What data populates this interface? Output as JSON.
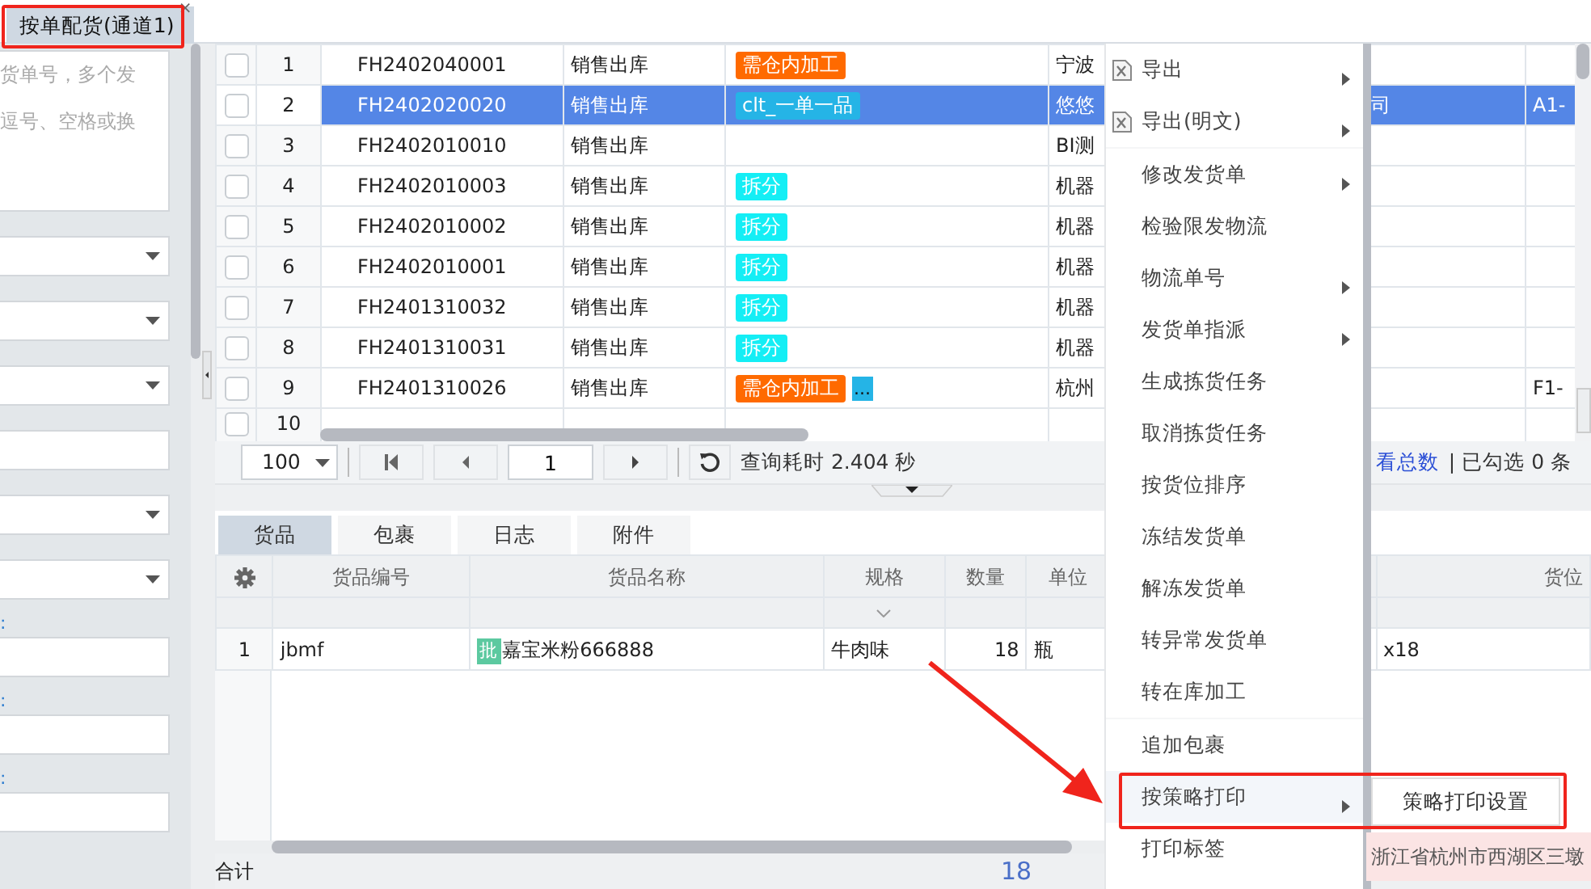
{
  "tab": {
    "label": "按单配货(通道1)",
    "close": "×",
    "selected": true
  },
  "filter_panel": {
    "placeholder": "货单号，多个发逗号、空格或换",
    "fields": [
      {
        "kind": "select"
      },
      {
        "kind": "select"
      },
      {
        "kind": "select"
      },
      {
        "kind": "input"
      },
      {
        "kind": "select"
      },
      {
        "kind": "select"
      },
      {
        "kind": "input",
        "label": ":"
      },
      {
        "kind": "input",
        "label": ":"
      },
      {
        "kind": "input",
        "label": ":"
      }
    ]
  },
  "orders": {
    "rows": [
      {
        "no": "1",
        "code": "FH2402040001",
        "type": "销售出库",
        "tags": [
          {
            "text": "需仓内加工",
            "color": "#ff6a00"
          }
        ],
        "column_5": "宁波",
        "column_6": "",
        "column_7": "",
        "checked": false,
        "selected": false
      },
      {
        "no": "2",
        "code": "FH2402020020",
        "type": "销售出库",
        "tags": [
          {
            "text": "clt_一单一品",
            "color": "#25b4e6"
          }
        ],
        "column_5": "悠悠",
        "column_6": "司",
        "column_7": "A1-",
        "checked": false,
        "selected": true
      },
      {
        "no": "3",
        "code": "FH2402010010",
        "type": "销售出库",
        "tags": [],
        "column_5": "BI测",
        "column_6": "",
        "column_7": "",
        "checked": false,
        "selected": false
      },
      {
        "no": "4",
        "code": "FH2402010003",
        "type": "销售出库",
        "tags": [
          {
            "text": "拆分",
            "color": "#14eef5"
          }
        ],
        "column_5": "机器",
        "column_6": "",
        "column_7": "",
        "checked": false,
        "selected": false
      },
      {
        "no": "5",
        "code": "FH2402010002",
        "type": "销售出库",
        "tags": [
          {
            "text": "拆分",
            "color": "#14eef5"
          }
        ],
        "column_5": "机器",
        "column_6": "",
        "column_7": "",
        "checked": false,
        "selected": false
      },
      {
        "no": "6",
        "code": "FH2402010001",
        "type": "销售出库",
        "tags": [
          {
            "text": "拆分",
            "color": "#14eef5"
          }
        ],
        "column_5": "机器",
        "column_6": "",
        "column_7": "",
        "checked": false,
        "selected": false
      },
      {
        "no": "7",
        "code": "FH2401310032",
        "type": "销售出库",
        "tags": [
          {
            "text": "拆分",
            "color": "#14eef5"
          }
        ],
        "column_5": "机器",
        "column_6": "",
        "column_7": "",
        "checked": false,
        "selected": false
      },
      {
        "no": "8",
        "code": "FH2401310031",
        "type": "销售出库",
        "tags": [
          {
            "text": "拆分",
            "color": "#14eef5"
          }
        ],
        "column_5": "机器",
        "column_6": "",
        "column_7": "",
        "checked": false,
        "selected": false
      },
      {
        "no": "9",
        "code": "FH2401310026",
        "type": "销售出库",
        "tags": [
          {
            "text": "需仓内加工",
            "color": "#ff6a00"
          }
        ],
        "more": "...",
        "column_5": "杭州",
        "column_6": "",
        "column_7": "F1-",
        "checked": false,
        "selected": false
      },
      {
        "no": "10",
        "code": "",
        "type": "",
        "tags": [],
        "column_5": "",
        "column_6": "",
        "column_7": "",
        "checked": false,
        "selected": false
      }
    ]
  },
  "pager": {
    "page_size": "100",
    "page": "1",
    "query_time": "查询耗时 2.404 秒",
    "total_link": "看总数",
    "checked_count": "| 已勾选 0 条"
  },
  "detail_tabs": [
    {
      "label": "货品",
      "selected": true
    },
    {
      "label": "包裹",
      "selected": false
    },
    {
      "label": "日志",
      "selected": false
    },
    {
      "label": "附件",
      "selected": false
    }
  ],
  "items": {
    "columns": [
      "货品编号",
      "货品名称",
      "规格",
      "数量",
      "单位",
      "",
      "货位"
    ],
    "rows": [
      {
        "no": "1",
        "code": "jbmf",
        "badge": "批",
        "name": "嘉宝米粉666888",
        "spec": "牛肉味",
        "qty": "18",
        "unit": "瓶",
        "column_7": "x18"
      }
    ],
    "total_label": "合计",
    "total_qty": "18"
  },
  "address_tip": "浙江省杭州市西湖区三墩",
  "context_menu": {
    "sections": [
      [
        {
          "label": "导出",
          "kind": "export",
          "has_submenu": true,
          "expanded": false
        },
        {
          "label": "导出(明文)",
          "kind": "export",
          "has_submenu": true,
          "expanded": false
        }
      ],
      [
        {
          "label": "修改发货单",
          "kind": "plain",
          "has_submenu": true,
          "expanded": false
        },
        {
          "label": "检验限发物流",
          "kind": "plain",
          "has_submenu": false,
          "expanded": false
        },
        {
          "label": "物流单号",
          "kind": "plain",
          "has_submenu": true,
          "expanded": false
        },
        {
          "label": "发货单指派",
          "kind": "plain",
          "has_submenu": true,
          "expanded": false
        },
        {
          "label": "生成拣货任务",
          "kind": "plain",
          "has_submenu": false,
          "expanded": false
        },
        {
          "label": "取消拣货任务",
          "kind": "plain",
          "has_submenu": false,
          "expanded": false
        },
        {
          "label": "按货位排序",
          "kind": "plain",
          "has_submenu": false,
          "expanded": false
        },
        {
          "label": "冻结发货单",
          "kind": "plain",
          "has_submenu": false,
          "expanded": false
        },
        {
          "label": "解冻发货单",
          "kind": "plain",
          "has_submenu": false,
          "expanded": false
        },
        {
          "label": "转异常发货单",
          "kind": "plain",
          "has_submenu": false,
          "expanded": false
        },
        {
          "label": "转在库加工",
          "kind": "plain",
          "has_submenu": false,
          "expanded": false
        }
      ],
      [
        {
          "label": "追加包裹",
          "kind": "plain",
          "has_submenu": false,
          "expanded": false
        },
        {
          "label": "按策略打印",
          "kind": "plain",
          "has_submenu": true,
          "expanded": true,
          "submenu": [
            "策略打印设置"
          ]
        },
        {
          "label": "打印标签",
          "kind": "plain",
          "has_submenu": false,
          "expanded": false
        }
      ]
    ]
  }
}
